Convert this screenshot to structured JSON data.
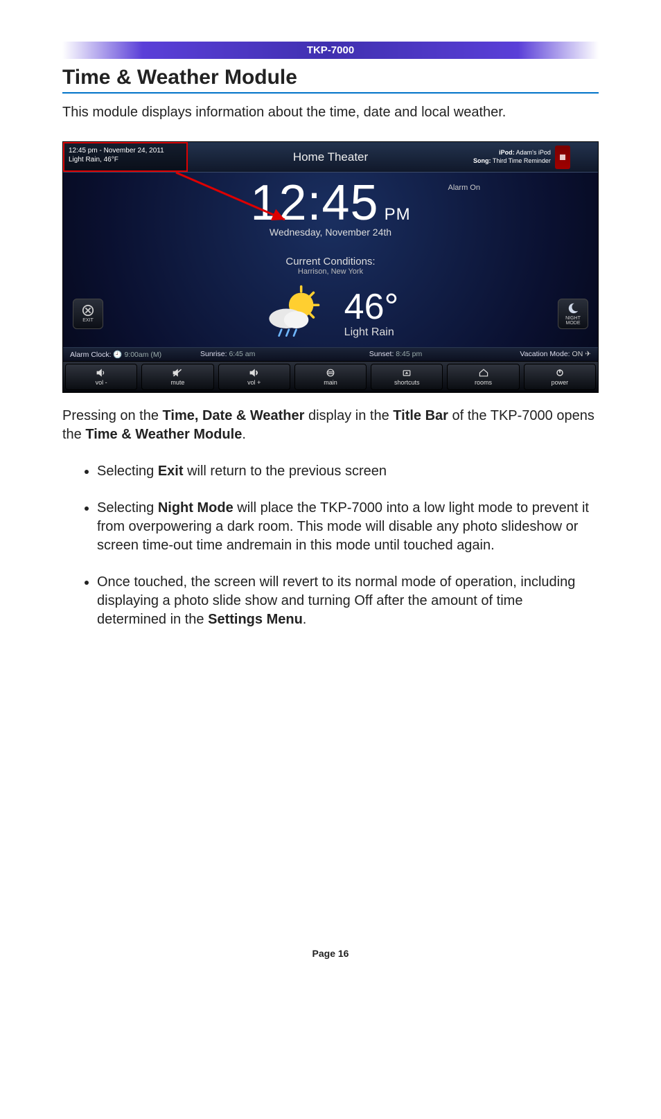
{
  "header": {
    "model": "TKP-7000"
  },
  "section": {
    "title": "Time & Weather Module"
  },
  "intro": "This module displays information about the time, date and local weather.",
  "shot": {
    "titlebar": {
      "left_line1": "12:45 pm - November 24, 2011",
      "left_line2": "Light Rain, 46°F",
      "center": "Home Theater",
      "right_ipod_label": "iPod:",
      "right_ipod_value": "Adam's iPod",
      "right_song_label": "Song:",
      "right_song_value": "Third Time Reminder"
    },
    "clock": {
      "time": "12:45",
      "ampm": "PM",
      "alarm": "Alarm On",
      "date": "Wednesday, November 24th"
    },
    "conditions": {
      "heading": "Current Conditions:",
      "location": "Harrison, New York",
      "temp": "46°",
      "desc": "Light Rain"
    },
    "side": {
      "exit": "EXIT",
      "night": "NIGHT\nMODE"
    },
    "status": {
      "alarm_label": "Alarm Clock:",
      "alarm_value": "9:00am (M)",
      "sunrise_label": "Sunrise:",
      "sunrise_value": "6:45 am",
      "sunset_label": "Sunset:",
      "sunset_value": "8:45 pm",
      "vacation_label": "Vacation Mode:",
      "vacation_value": "ON"
    },
    "bottom": {
      "vol_down": "vol -",
      "mute": "mute",
      "vol_up": "vol +",
      "main": "main",
      "shortcuts": "shortcuts",
      "rooms": "rooms",
      "power": "power"
    }
  },
  "para2_parts": [
    "Pressing on the ",
    "Time, Date & Weather",
    " display in the ",
    "Title Bar",
    " of the TKP-7000 opens the ",
    "Time & Weather Module",
    "."
  ],
  "bullets": {
    "b1_pre": "Selecting ",
    "b1_bold": "Exit",
    "b1_post": " will return to the previous screen",
    "b2_pre": "Selecting ",
    "b2_bold": "Night Mode",
    "b2_post": " will place the TKP-7000 into a low light mode to prevent it from overpowering a dark room. This mode will disable any photo slideshow or screen time-out time andremain in  this mode until touched again.",
    "b3_pre": "Once touched, the screen will revert to its normal mode of operation, including displaying a photo slide show and turning Off after the amount of time determined in the ",
    "b3_bold": "Settings Menu",
    "b3_post": "."
  },
  "page": "Page 16"
}
